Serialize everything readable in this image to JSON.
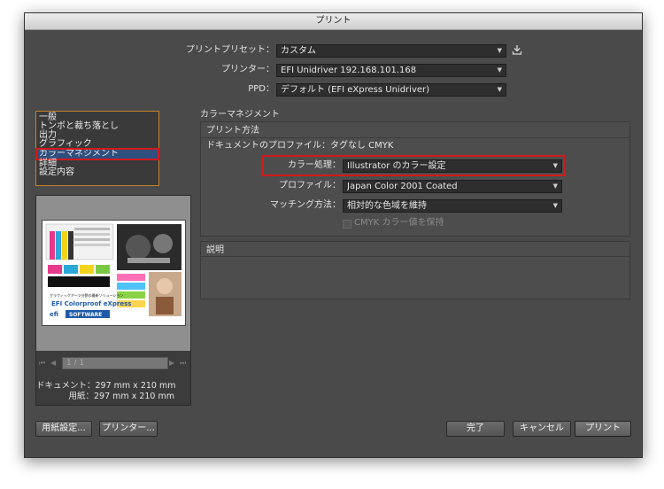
{
  "window": {
    "title": "プリント"
  },
  "preset": {
    "label": "プリントプリセット：",
    "value": "カスタム"
  },
  "printer": {
    "label": "プリンター：",
    "value": "EFI Unidriver 192.168.101.168"
  },
  "ppd": {
    "label": "PPD：",
    "value": "デフォルト (EFI eXpress Unidriver)"
  },
  "sidebar": {
    "items": [
      {
        "label": "一般"
      },
      {
        "label": "トンボと裁ち落とし"
      },
      {
        "label": "出力"
      },
      {
        "label": "グラフィック"
      },
      {
        "label": "カラーマネジメント"
      },
      {
        "label": "詳細"
      },
      {
        "label": "設定内容"
      }
    ]
  },
  "color_management": {
    "heading": "カラーマネジメント",
    "print_method": "プリント方法",
    "doc_profile": "ドキュメントのプロファイル：タグなし CMYK",
    "color_handling_label": "カラー処理：",
    "color_handling_value": "Illustrator のカラー設定",
    "profile_label": "プロファイル：",
    "profile_value": "Japan Color 2001 Coated",
    "matching_label": "マッチング方法：",
    "matching_value": "相対的な色域を維持",
    "preserve_cmyk": "CMYK カラー値を保持"
  },
  "description": {
    "heading": "説明"
  },
  "preview": {
    "page_indicator": "1 / 1",
    "doc_size": "ドキュメント：297 mm x 210 mm",
    "paper_size": "用紙：297 mm x 210 mm",
    "thumb_brand": "EFI Colorproof eXpress",
    "thumb_software": "SOFTWARE",
    "thumb_efi": "efi",
    "thumb_caption": "グラフィックアーツ分野の最新ソリューション"
  },
  "buttons": {
    "page_setup": "用紙設定...",
    "printer": "プリンター...",
    "done": "完了",
    "cancel": "キャンセル",
    "print": "プリント"
  }
}
